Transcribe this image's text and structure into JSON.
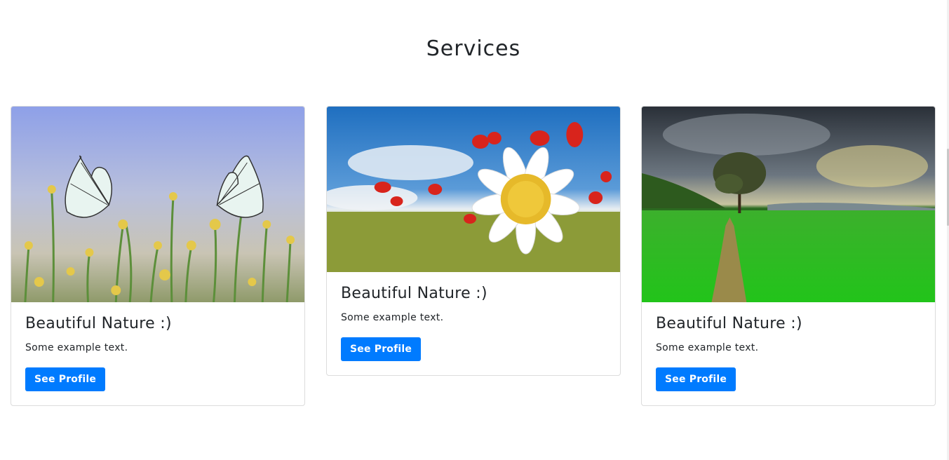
{
  "section": {
    "title": "Services"
  },
  "cards": [
    {
      "title": "Beautiful Nature :)",
      "text": "Some example text.",
      "button": "See Profile",
      "image": "butterflies-flowers-photo"
    },
    {
      "title": "Beautiful Nature :)",
      "text": "Some example text.",
      "button": "See Profile",
      "image": "daisy-poppies-photo"
    },
    {
      "title": "Beautiful Nature :)",
      "text": "Some example text.",
      "button": "See Profile",
      "image": "tree-green-field-photo"
    }
  ],
  "colors": {
    "button": "#007bff",
    "text": "#212529",
    "border": "#dcdcdc"
  }
}
